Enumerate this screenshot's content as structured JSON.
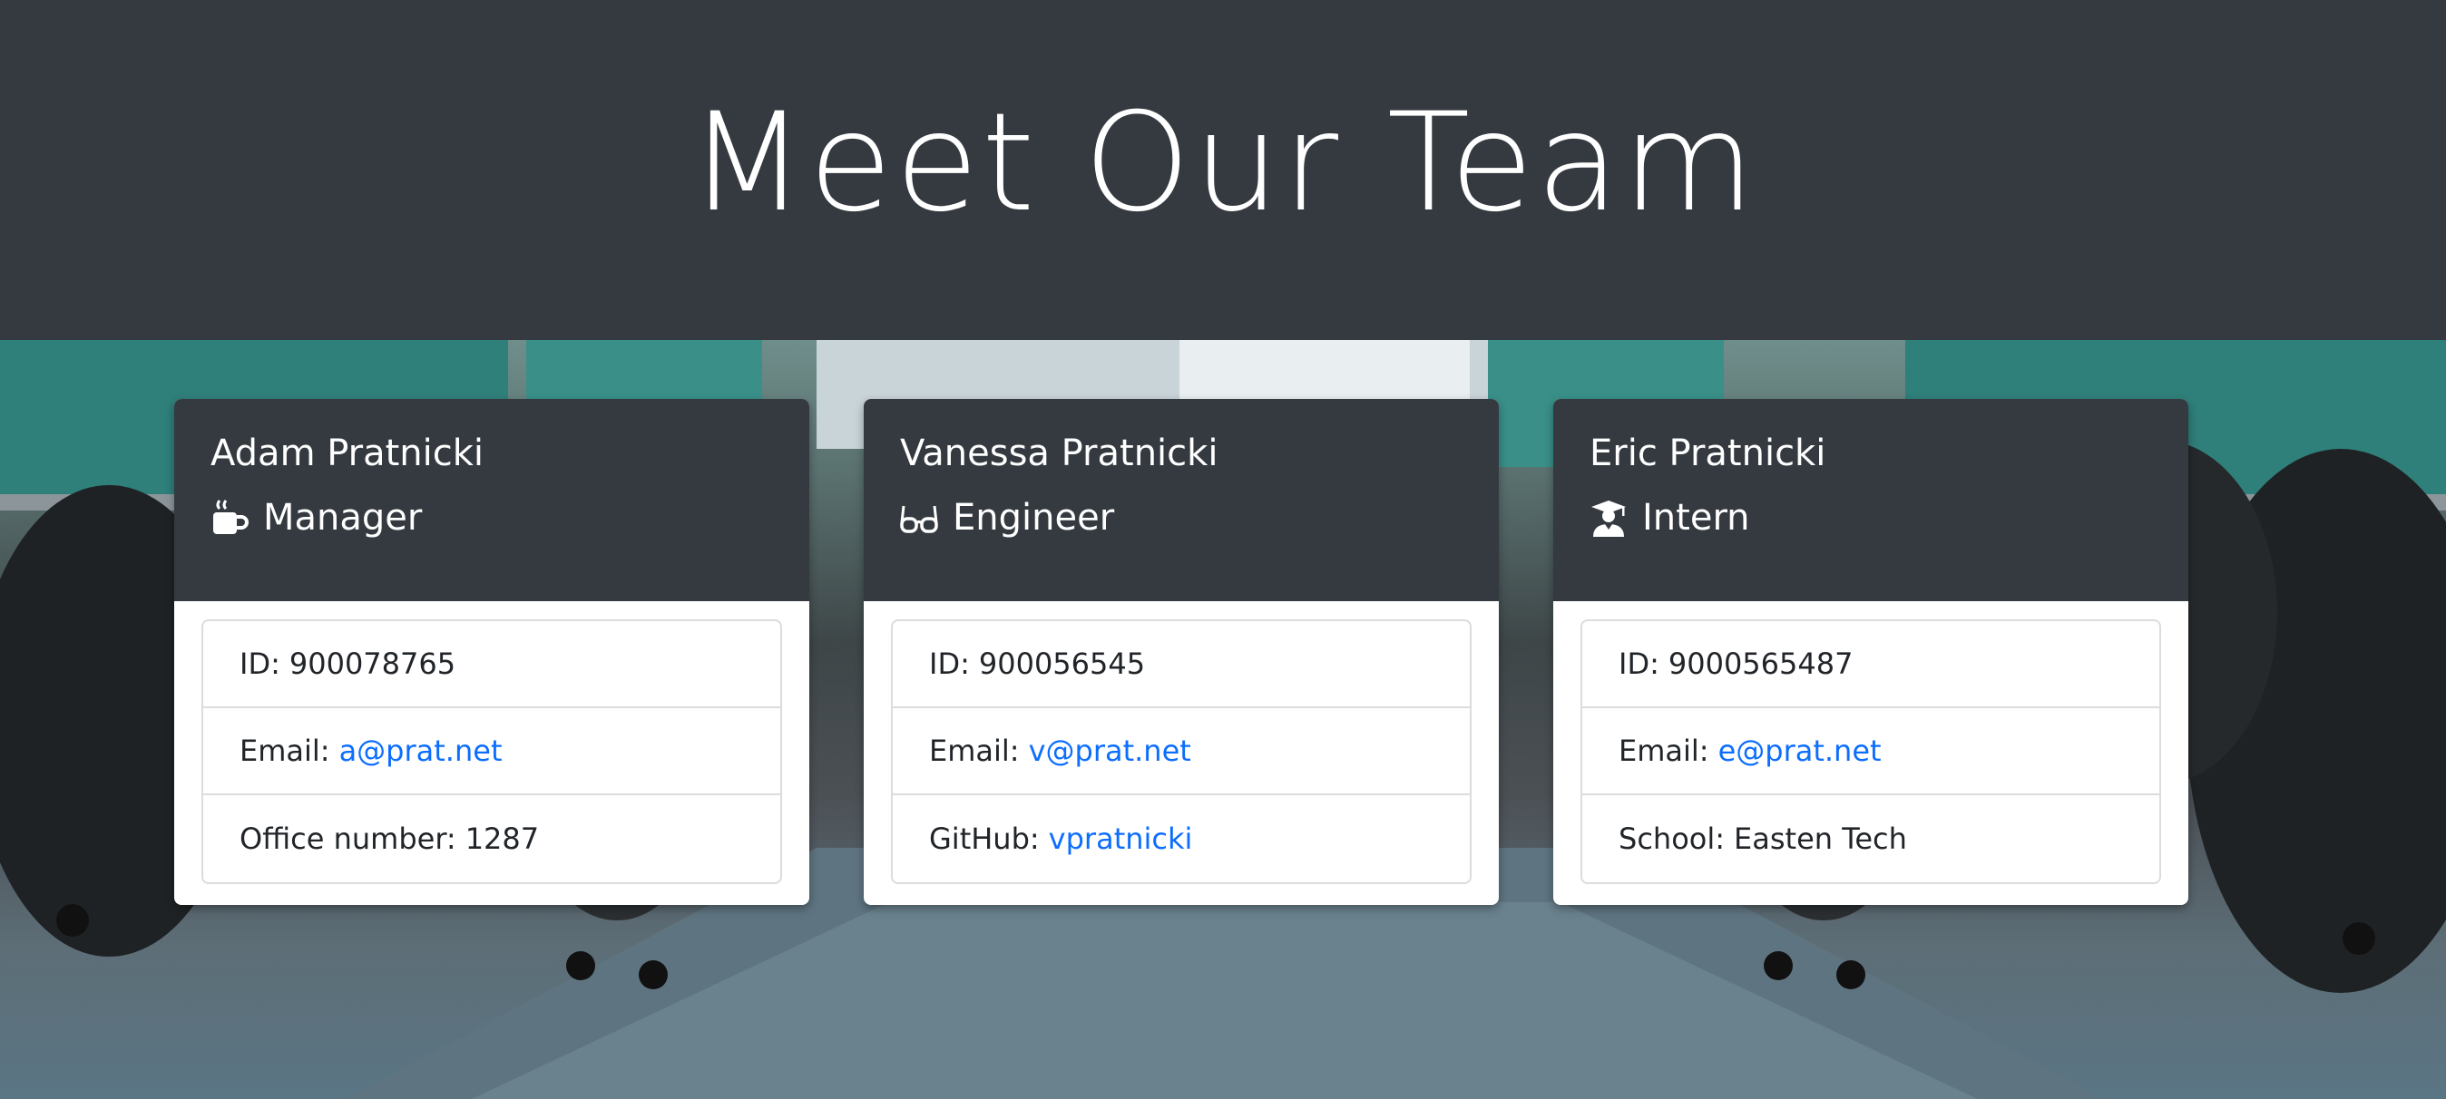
{
  "header": {
    "title": "Meet Our Team"
  },
  "team": [
    {
      "name": "Adam Pratnicki",
      "role": "Manager",
      "role_icon": "coffee-mug-icon",
      "id_label": "ID:",
      "id_value": "900078765",
      "email_label": "Email:",
      "email": "a@prat.net",
      "extra_label": "Office number:",
      "extra_value": "1287",
      "extra_is_link": false
    },
    {
      "name": "Vanessa Pratnicki",
      "role": "Engineer",
      "role_icon": "glasses-icon",
      "id_label": "ID:",
      "id_value": "900056545",
      "email_label": "Email:",
      "email": "v@prat.net",
      "extra_label": "GitHub:",
      "extra_value": "vpratnicki",
      "extra_is_link": true
    },
    {
      "name": "Eric Pratnicki",
      "role": "Intern",
      "role_icon": "graduate-icon",
      "id_label": "ID:",
      "id_value": "9000565487",
      "email_label": "Email:",
      "email": "e@prat.net",
      "extra_label": "School:",
      "extra_value": "Easten Tech",
      "extra_is_link": false
    }
  ],
  "colors": {
    "header_bg": "#343a40",
    "link": "#0d6efd"
  }
}
